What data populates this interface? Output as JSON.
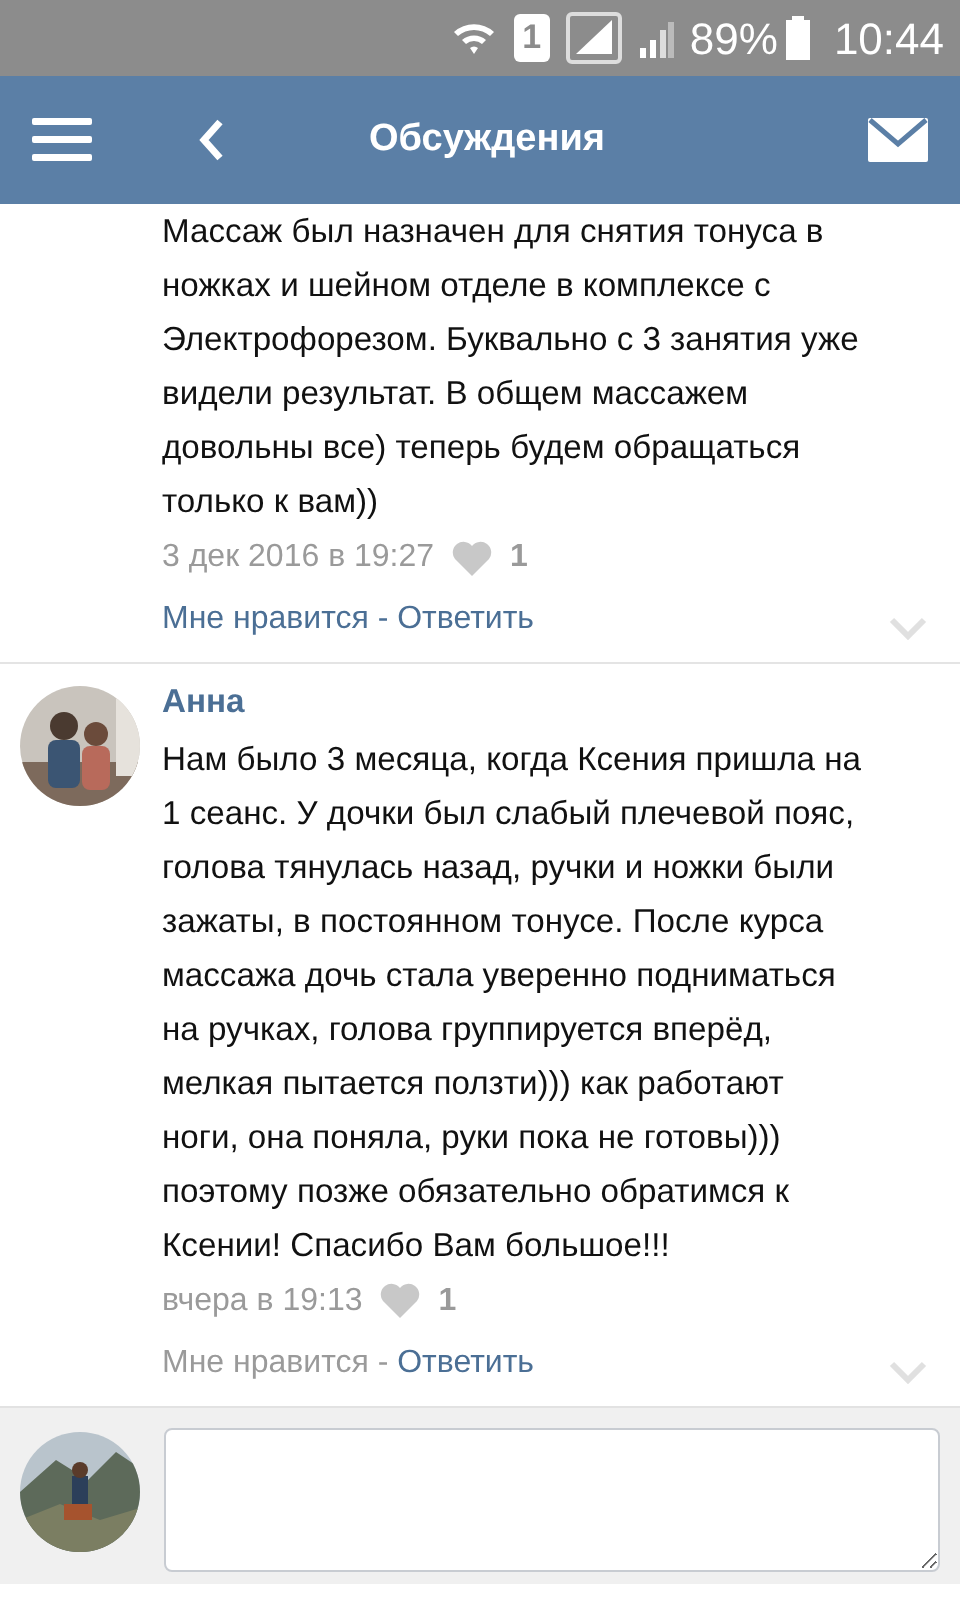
{
  "status_bar": {
    "sim_slot": "1",
    "battery": "89%",
    "time": "10:44"
  },
  "header": {
    "title": "Обсуждения"
  },
  "comments": [
    {
      "text": "Массаж был назначен для снятия тонуса в\nножках и шейном отделе в комплексе с\nЭлектрофорезом. Буквально с 3 занятия уже\nвидели результат. В общем массажем\nдовольны все) теперь будем обращаться\nтолько к вам))",
      "date": "3 дек 2016 в 19:27",
      "likes": "1",
      "like_label": "Мне нравится",
      "separator": " - ",
      "reply_label": "Ответить",
      "like_disabled": false
    },
    {
      "author": "Анна",
      "text": "Нам было 3 месяца, когда Ксения пришла на\n1 сеанс. У дочки был слабый плечевой пояс,\nголова тянулась назад, ручки и ножки были\nзажаты, в постоянном тонусе. После курса\nмассажа дочь стала уверенно подниматься\nна ручках, голова группируется вперёд,\nмелкая пытается ползти))) как работают\nноги, она поняла, руки пока не готовы)))\nпоэтому позже обязательно обратимся к\nКсении! Спасибо Вам большое!!!",
      "date": "вчера в 19:13",
      "likes": "1",
      "like_label": "Мне нравится",
      "separator": " - ",
      "reply_label": "Ответить",
      "like_disabled": true
    }
  ]
}
